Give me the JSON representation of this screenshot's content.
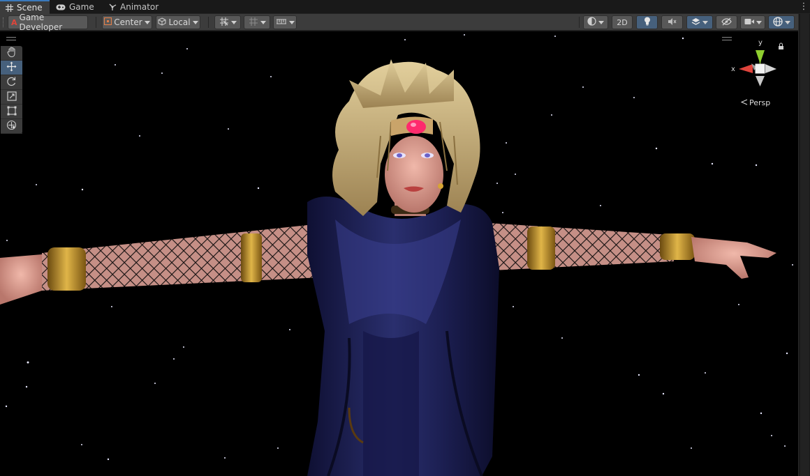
{
  "tabs": [
    {
      "label": "Scene",
      "icon": "grid-icon",
      "active": true
    },
    {
      "label": "Game",
      "icon": "gamepad-icon",
      "active": false
    },
    {
      "label": "Animator",
      "icon": "animator-icon",
      "active": false
    }
  ],
  "toolbar": {
    "layout_label": "Game Developer",
    "pivot_label": "Center",
    "space_label": "Local",
    "mode_2d_label": "2D"
  },
  "gizmo": {
    "y_label": "y",
    "x_label": "x",
    "projection_label": "Persp"
  },
  "colors": {
    "panel": "#3c3c3c",
    "active_button": "#46607c",
    "cloak": "#1a1d4a",
    "hair": "#c9b27d",
    "gold": "#b8871f",
    "gem": "#ff2a6d",
    "skin": "#e2a79b"
  }
}
